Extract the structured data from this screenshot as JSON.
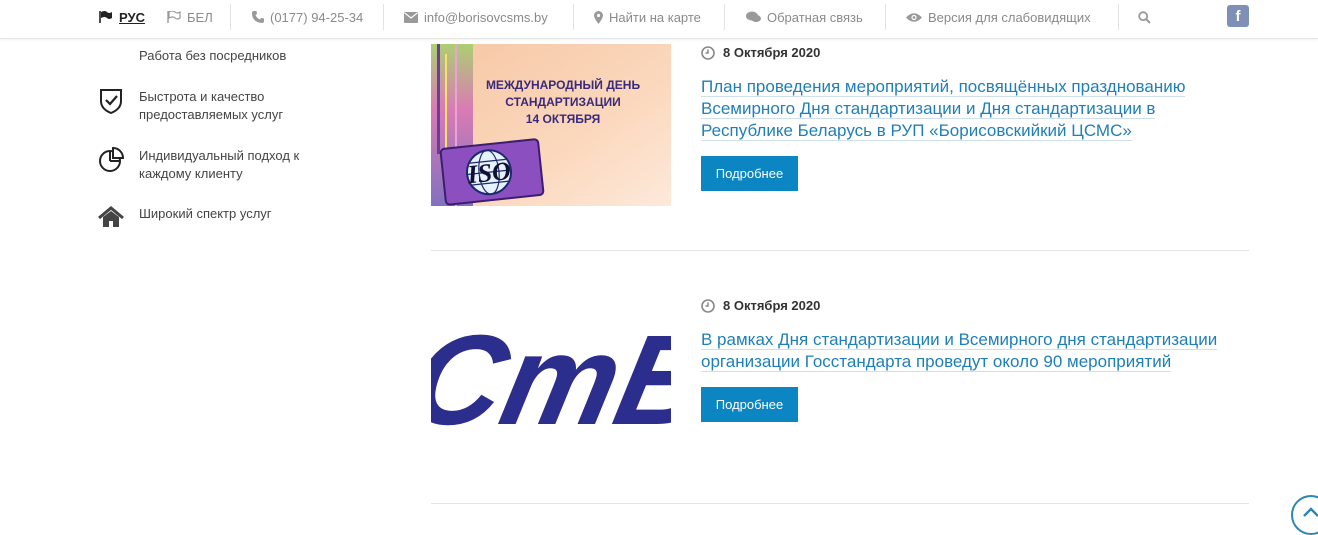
{
  "topbar": {
    "lang_ru": "РУС",
    "lang_be": "БЕЛ",
    "phone": "(0177) 94-25-34",
    "email": "info@borisovcsms.by",
    "map": "Найти на карте",
    "feedback": "Обратная связь",
    "accessibility": "Версия для слабовидящих",
    "facebook": "f"
  },
  "features": [
    {
      "label": "Работа без посредников",
      "icon": "handshake-icon"
    },
    {
      "label": "Быстрота и качество предоставляемых услуг",
      "icon": "shield-check-icon"
    },
    {
      "label": "Индивидуальный подход к каждому клиенту",
      "icon": "pie-chart-icon"
    },
    {
      "label": "Широкий спектр услуг",
      "icon": "home-icon"
    }
  ],
  "news": [
    {
      "date": "8 Октября 2020",
      "title": "План проведения мероприятий, посвящённых празднованию Всемирного Дня стандартизации и Дня стандартизации в Республике Беларусь в РУП «Борисовскийкий ЦСМС»",
      "button": "Подробнее",
      "image_text": [
        "МЕЖДУНАРОДНЫЙ ДЕНЬ",
        "СТАНДАРТИЗАЦИИ",
        "14 ОКТЯБРЯ"
      ],
      "image_logo": "ISO"
    },
    {
      "date": "8 Октября 2020",
      "title": "В рамках Дня стандартизации и Всемирного дня стандартизации организации Госстандарта проведут около 90 мероприятий",
      "button": "Подробнее",
      "image_logo": "СтБ"
    }
  ],
  "colors": {
    "accent": "#0b86c2",
    "link": "#1f7fb8",
    "logo_blue": "#2b2e8c"
  }
}
